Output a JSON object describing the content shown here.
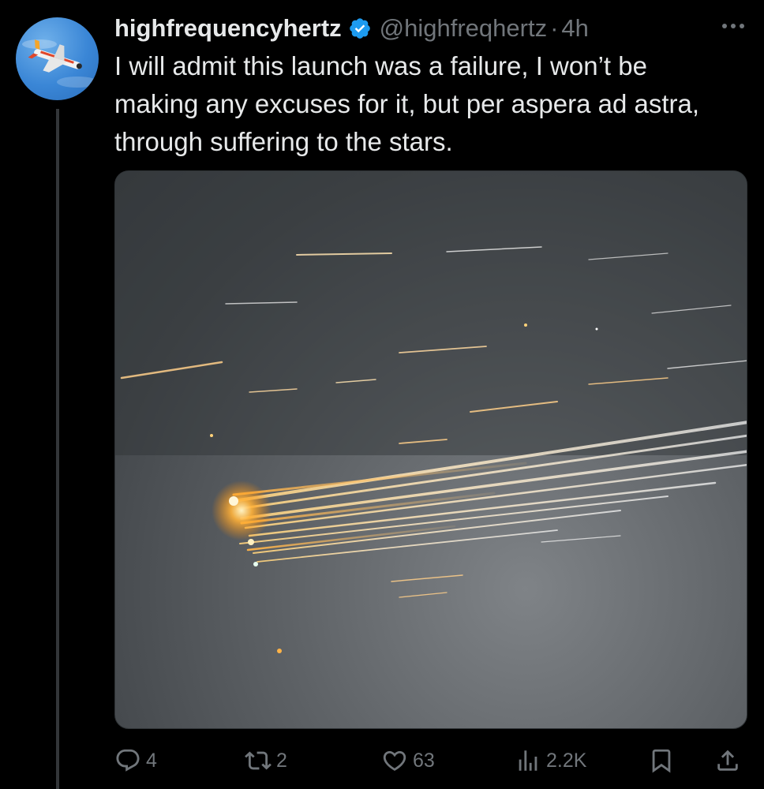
{
  "author": {
    "display_name": "highfrequencyhertz",
    "handle": "@highfreqhertz",
    "separator": "·",
    "time": "4h",
    "verified_color": "#1d9bf0"
  },
  "tweet": {
    "text": "I will admit this launch was a failure, I won’t be making any excuses for it, but per aspera ad astra, through suffering to the stars."
  },
  "media": {
    "description_icon": "rocket-debris-photo"
  },
  "actions": {
    "replies": "4",
    "retweets": "2",
    "likes": "63",
    "views": "2.2K"
  },
  "icons": {
    "reply": "speech-bubble-icon",
    "retweet": "retweet-arrows-icon",
    "like": "heart-icon",
    "views": "bar-chart-icon",
    "bookmark": "bookmark-icon",
    "share": "upload-arrow-icon",
    "more": "ellipsis-icon"
  },
  "colors": {
    "background": "#000000",
    "text_primary": "#e7e9ea",
    "text_secondary": "#71767b",
    "accent": "#1d9bf0"
  }
}
